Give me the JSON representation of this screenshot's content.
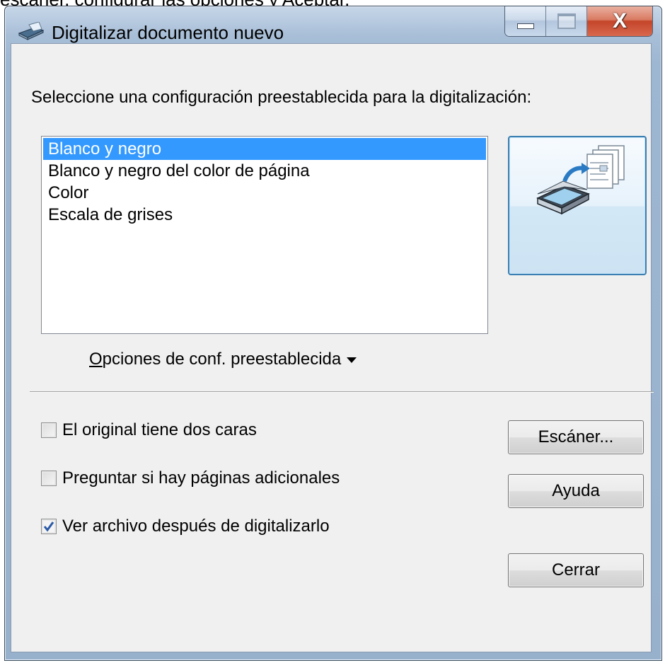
{
  "background_caption": "escáner, configurar las opciones y Aceptar.",
  "window": {
    "title": "Digitalizar documento nuevo",
    "icon": "scanner-icon",
    "caption_buttons": {
      "minimize": "minimize-icon",
      "maximize": "maximize-icon",
      "close": "X"
    }
  },
  "prompt": "Seleccione una configuración preestablecida para la digitalización:",
  "presets": {
    "items": [
      "Blanco y negro",
      "Blanco y negro del color de página",
      "Color",
      "Escala de grises"
    ],
    "selected": "Blanco y negro"
  },
  "scan_button_icon": "scan-document-icon",
  "preset_options": {
    "accel": "O",
    "rest": "pciones de conf. preestablecida"
  },
  "checkboxes": [
    {
      "label": "El original tiene dos caras",
      "checked": false
    },
    {
      "label": "Preguntar si hay páginas adicionales",
      "checked": false
    },
    {
      "label": "Ver archivo después de digitalizarlo",
      "checked": true
    }
  ],
  "buttons": {
    "scanner": "Escáner...",
    "help": "Ayuda",
    "close": "Cerrar"
  },
  "colors": {
    "selection": "#3399ff",
    "close_button": "#c4452a",
    "frame": "#9db6d2"
  }
}
